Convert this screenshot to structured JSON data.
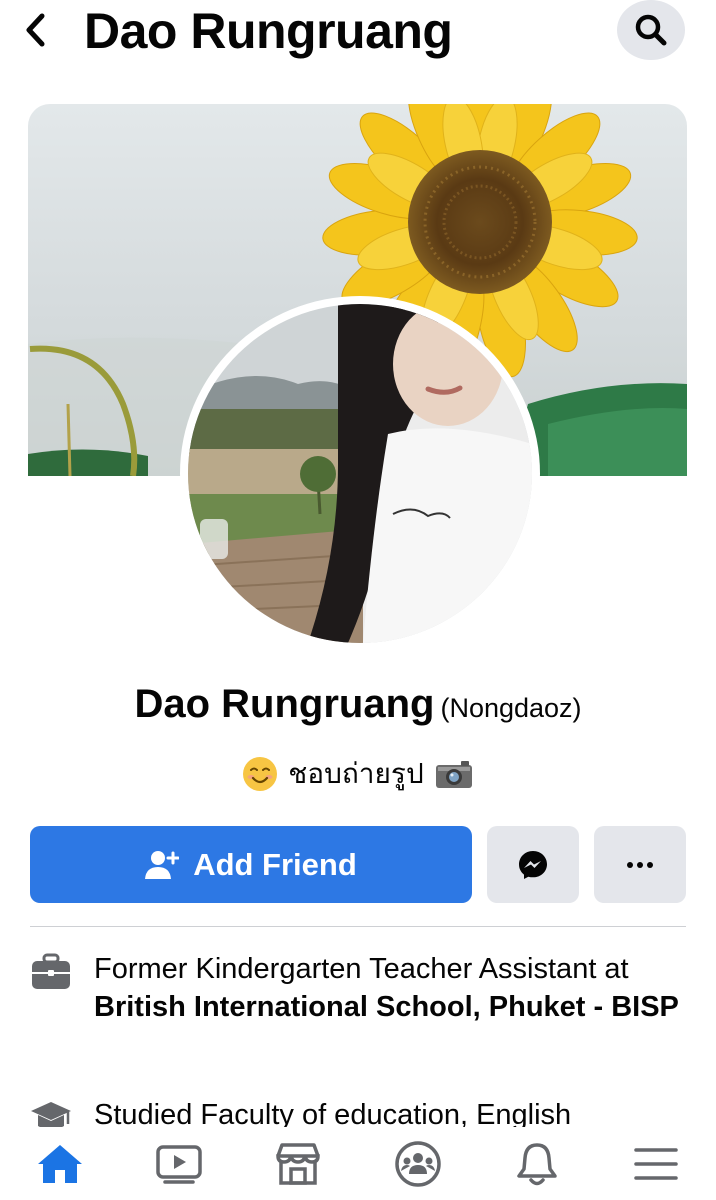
{
  "header": {
    "title": "Dao Rungruang",
    "back_icon": "chevron-left-icon",
    "search_icon": "search-icon"
  },
  "profile": {
    "name": "Dao Rungruang",
    "nickname": "(Nongdaoz)",
    "bio_text": "ชอบถ่ายรูป",
    "bio_emoji_before": "smiling-face-emoji",
    "bio_emoji_after": "camera-emoji"
  },
  "actions": {
    "add_friend_label": "Add Friend",
    "add_friend_icon": "person-add-icon",
    "messenger_icon": "messenger-icon",
    "more_icon": "more-dots-icon"
  },
  "intro": [
    {
      "icon": "briefcase-icon",
      "prefix": "Former Kindergarten Teacher Assistant at ",
      "bold": "British International School, Phuket - BISP"
    },
    {
      "icon": "graduation-cap-icon",
      "prefix": "Studied Faculty of education, English",
      "bold": ""
    }
  ],
  "nav": [
    {
      "name": "home",
      "icon": "home-icon",
      "active": true
    },
    {
      "name": "watch",
      "icon": "video-icon",
      "active": false
    },
    {
      "name": "marketplace",
      "icon": "shop-icon",
      "active": false
    },
    {
      "name": "groups",
      "icon": "groups-icon",
      "active": false
    },
    {
      "name": "notifications",
      "icon": "bell-icon",
      "active": false
    },
    {
      "name": "menu",
      "icon": "hamburger-menu-icon",
      "active": false
    }
  ],
  "colors": {
    "accent": "#2d78e4",
    "button_gray": "#e4e6eb",
    "text": "#050505"
  }
}
